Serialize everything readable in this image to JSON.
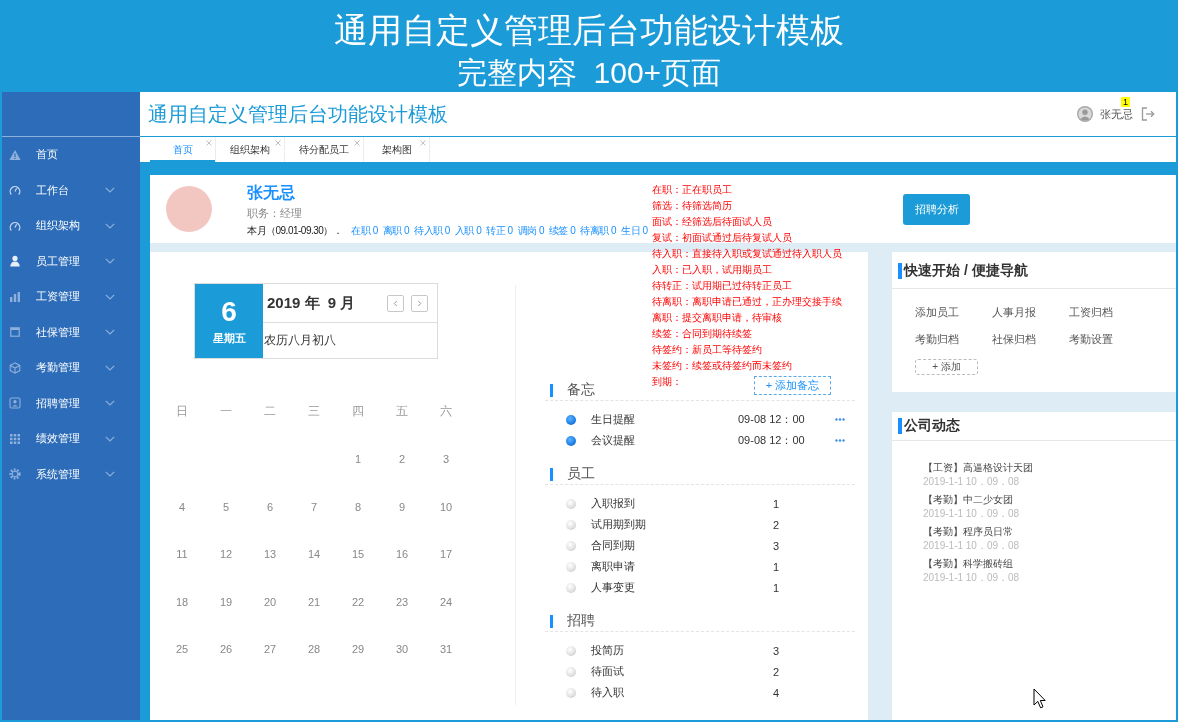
{
  "banner": {
    "title": "通用自定义管理后台功能设计模板",
    "subtitle": "完整内容  100+页面"
  },
  "header": {
    "title": "通用自定义管理后台功能设计模板",
    "user_name": "张无忌",
    "notification_badge": "1"
  },
  "sidebar": {
    "items": [
      {
        "label": "首页",
        "selected": false,
        "has_submenu": false
      },
      {
        "label": "工作台",
        "selected": false,
        "has_submenu": true
      },
      {
        "label": "组织架构",
        "selected": false,
        "has_submenu": true
      },
      {
        "label": "员工管理",
        "selected": false,
        "has_submenu": true
      },
      {
        "label": "工资管理",
        "selected": false,
        "has_submenu": true
      },
      {
        "label": "社保管理",
        "selected": false,
        "has_submenu": true
      },
      {
        "label": "考勤管理",
        "selected": false,
        "has_submenu": true
      },
      {
        "label": "招聘管理",
        "selected": false,
        "has_submenu": true
      },
      {
        "label": "绩效管理",
        "selected": false,
        "has_submenu": true
      },
      {
        "label": "系统管理",
        "selected": false,
        "has_submenu": true
      }
    ]
  },
  "tabs": [
    {
      "label": "首页",
      "selected": true
    },
    {
      "label": "组织架构",
      "selected": false
    },
    {
      "label": "待分配员工",
      "selected": false
    },
    {
      "label": "架构图",
      "selected": false
    }
  ],
  "profile": {
    "name": "张无忌",
    "position": "职务：经理",
    "period": "本月（09.01-09.30）．",
    "stats": [
      "在职 0",
      "离职 0",
      "待入职 0",
      "入职 0",
      "转正 0",
      "调岗 0",
      "续签 0",
      "待离职 0",
      "生日 0"
    ],
    "action_button": "招聘分析"
  },
  "status_legend": [
    "在职：正在职员工",
    "筛选：待筛选简历",
    "面试：经筛选后待面试人员",
    "复试：初面试通过后待复试人员",
    "待入职：直接待入职或复试通过待入职人员",
    "入职：已入职，试用期员工",
    "待转正：试用期已过待转正员工",
    "待离职：离职申请已通过，正办理交接手续",
    "离职：提交离职申请，待审核",
    "续签：合同到期待续签",
    "待签约：新员工等待签约",
    "未签约：续签或待签约而未签约",
    "到期："
  ],
  "calendar": {
    "day": "6",
    "weekday": "星期五",
    "month": "2019 年  9 月",
    "lunar": "农历八月初八",
    "weekday_names": [
      "日",
      "一",
      "二",
      "三",
      "四",
      "五",
      "六"
    ],
    "weeks": [
      [
        "1",
        "2",
        "3"
      ],
      [
        "4",
        "5",
        "6",
        "7",
        "8",
        "9",
        "10"
      ],
      [
        "11",
        "12",
        "13",
        "14",
        "15",
        "16",
        "17"
      ],
      [
        "18",
        "19",
        "20",
        "21",
        "22",
        "23",
        "24"
      ],
      [
        "25",
        "26",
        "27",
        "28",
        "29",
        "30",
        "31"
      ]
    ]
  },
  "memo": {
    "title": "备忘",
    "add_button": "+ 添加备忘",
    "items": [
      {
        "label": "生日提醒",
        "time": "09-08 12：00"
      },
      {
        "label": "会议提醒",
        "time": "09-08 12：00"
      }
    ]
  },
  "employee": {
    "title": "员工",
    "items": [
      {
        "label": "入职报到",
        "count": "1"
      },
      {
        "label": "试用期到期",
        "count": "2"
      },
      {
        "label": "合同到期",
        "count": "3"
      },
      {
        "label": "离职申请",
        "count": "1"
      },
      {
        "label": "人事变更",
        "count": "1"
      }
    ]
  },
  "recruitment": {
    "title": "招聘",
    "items": [
      {
        "label": "投简历",
        "count": "3"
      },
      {
        "label": "待面试",
        "count": "2"
      },
      {
        "label": "待入职",
        "count": "4"
      }
    ]
  },
  "quick_nav": {
    "title": "快速开始 / 便捷导航",
    "links": [
      "添加员工",
      "人事月报",
      "工资归档",
      "考勤归档",
      "社保归档",
      "考勤设置"
    ],
    "add_button": "+ 添加"
  },
  "company_news": {
    "title": "公司动态",
    "items": [
      {
        "title": "【工资】高逼格设计天团",
        "time": "2019-1-1 10．09．08"
      },
      {
        "title": "【考勤】中二少女团",
        "time": "2019-1-1 10．09．08"
      },
      {
        "title": "【考勤】程序员日常",
        "time": "2019-1-1 10．09．08"
      },
      {
        "title": "【考勤】科学搬砖组",
        "time": "2019-1-1 10．09．08"
      }
    ]
  }
}
